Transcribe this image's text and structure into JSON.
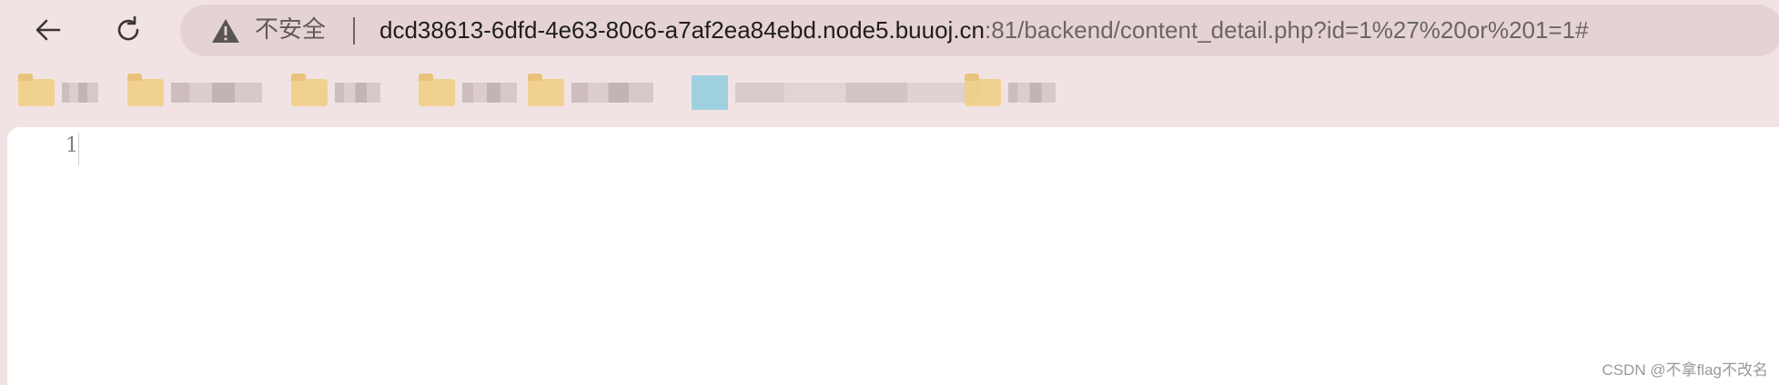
{
  "browser": {
    "security_label": "不安全",
    "url_host": "dcd38613-6dfd-4e63-80c6-a7af2ea84ebd.node5.buuoj.cn",
    "url_path": ":81/backend/content_detail.php?id=1%27%20or%201=1#",
    "icons": {
      "back": "back-arrow-icon",
      "reload": "reload-icon",
      "security": "warning-triangle-icon"
    }
  },
  "bookmarks": {
    "note": "",
    "items": [
      {
        "icon": "folder-icon"
      },
      {
        "icon": "folder-icon"
      },
      {
        "icon": "folder-icon"
      },
      {
        "icon": "folder-icon"
      },
      {
        "icon": "folder-icon"
      },
      {
        "icon": "site-favicon"
      },
      {
        "icon": "folder-icon"
      }
    ]
  },
  "viewer": {
    "line_number": "1",
    "source_text": ""
  },
  "watermark": "CSDN @不拿flag不改名"
}
